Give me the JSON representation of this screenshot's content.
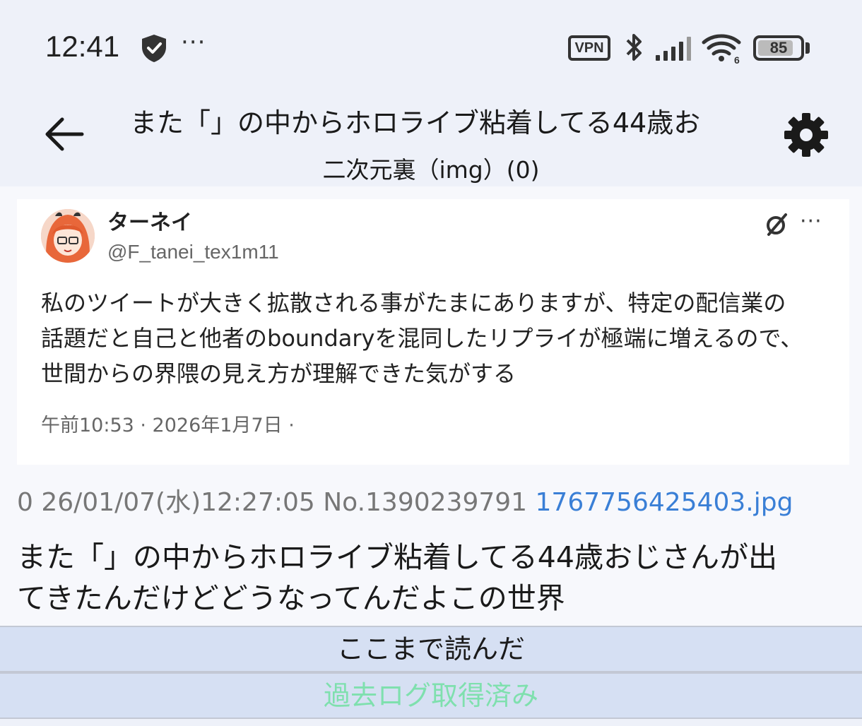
{
  "status_bar": {
    "time": "12:41",
    "more": "···",
    "vpn": "VPN",
    "wifi_badge": "6",
    "battery": "85",
    "battery_level_percent": 85
  },
  "header": {
    "title": "また「」の中からホロライブ粘着してる44歳お",
    "subtitle": "二次元裏（img）(0)"
  },
  "tweet": {
    "name": "ターネイ",
    "handle": "@F_tanei_tex1m11",
    "more": "···",
    "body_lines": [
      "私のツイートが大きく拡散される事がたまにありますが、特定の配信業の",
      "話題だと自己と他者のboundaryを混同したリプライが極端に増えるので、",
      "世間からの界隈の見え方が理解できた気がする"
    ],
    "timestamp": "午前10:53 · 2026年1月7日 ·"
  },
  "post": {
    "meta": "0 26/01/07(水)12:27:05 No.1390239791",
    "file": "1767756425403.jpg",
    "body_lines": [
      "また「」の中からホロライブ粘着してる44歳おじさんが出",
      "てきたんだけどどうなってんだよこの世界"
    ]
  },
  "bars": {
    "read_marker": "ここまで読んだ",
    "archive_status": "過去ログ取得済み"
  },
  "colors": {
    "background": "#eef1f9",
    "bar": "#d6e0f3",
    "link": "#3a7fd6",
    "archive_text": "#7fe0ae"
  }
}
